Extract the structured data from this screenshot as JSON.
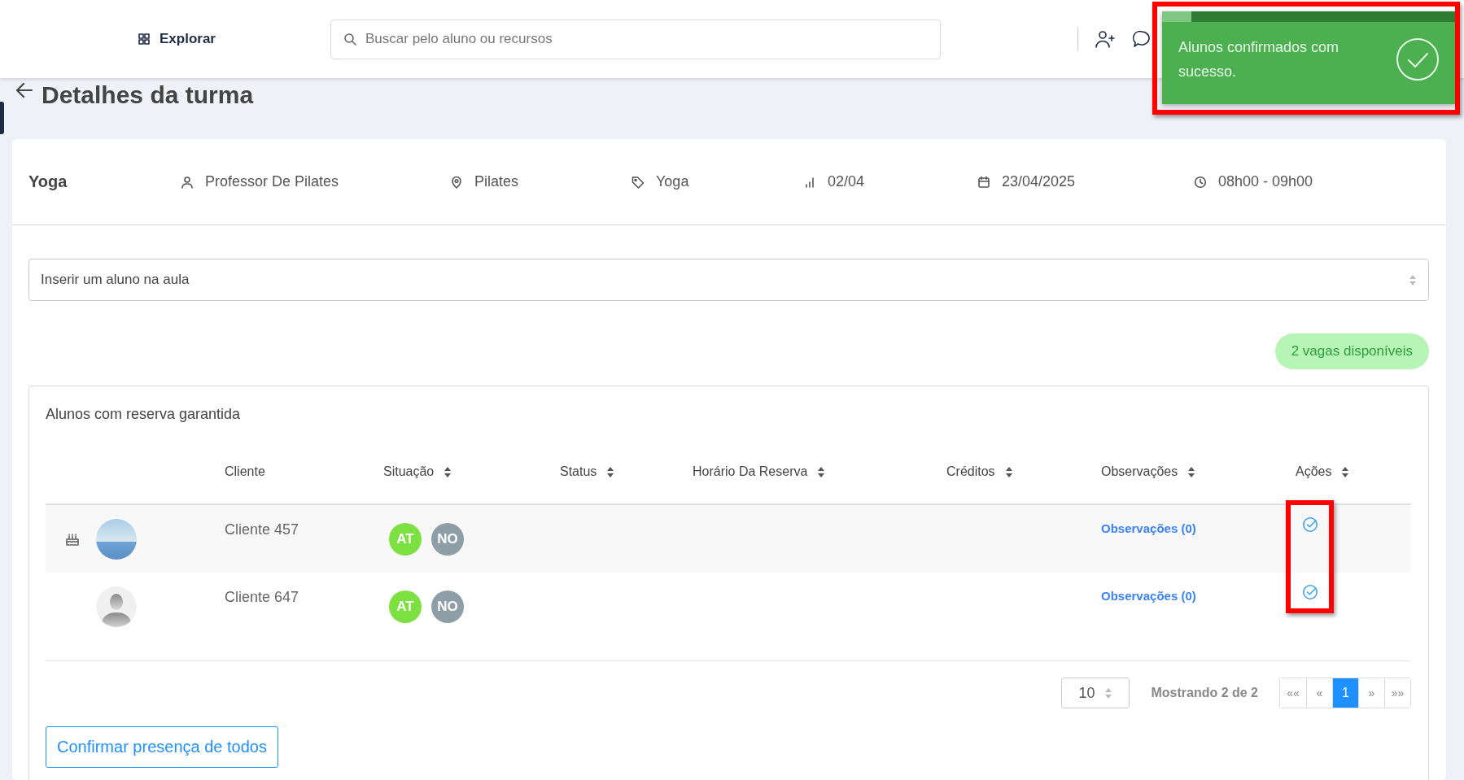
{
  "topbar": {
    "explore_label": "Explorar",
    "search": {
      "placeholder": "Buscar pelo aluno ou recursos"
    }
  },
  "toast": {
    "message": "Alunos confirmados com sucesso.",
    "level": 0.1
  },
  "page_title": "Detalhes da turma",
  "class_info": {
    "name": "Yoga",
    "items": [
      {
        "kind": "teacher",
        "text": "Professor De Pilates"
      },
      {
        "kind": "location",
        "text": "Pilates"
      },
      {
        "kind": "tag",
        "text": "Yoga"
      },
      {
        "kind": "capacity",
        "text": "02/04"
      },
      {
        "kind": "date",
        "text": "23/04/2025"
      },
      {
        "kind": "time",
        "text": "08h00 - 09h00"
      }
    ]
  },
  "student_select": {
    "placeholder": "Inserir um aluno na aula"
  },
  "vacancies": "2 vagas disponíveis",
  "panel": {
    "title": "Alunos com reserva garantida",
    "columns": [
      {
        "label": "Cliente",
        "sortable": false
      },
      {
        "label": "Situação",
        "sortable": true
      },
      {
        "label": "Status",
        "sortable": true
      },
      {
        "label": "Horário Da Reserva",
        "sortable": true
      },
      {
        "label": "Créditos",
        "sortable": true
      },
      {
        "label": "Observações",
        "sortable": true
      },
      {
        "label": "Ações",
        "sortable": true
      }
    ],
    "rows": [
      {
        "client": "Cliente 457",
        "birthday": true,
        "kind": "photo",
        "badges": [
          {
            "text": "AT",
            "color": "#7be040"
          },
          {
            "text": "NO",
            "color": "#8e9ea6"
          }
        ],
        "observations": "Observações (0)"
      },
      {
        "client": "Cliente 647",
        "birthday": false,
        "kind": "silhouette",
        "badges": [
          {
            "text": "AT",
            "color": "#7be040"
          },
          {
            "text": "NO",
            "color": "#8e9ea6"
          }
        ],
        "observations": "Observações (0)"
      }
    ],
    "pagination": {
      "page_size": "10",
      "summary": "Mostrando 2 de 2",
      "pages": [
        {
          "label": "««",
          "selected": false
        },
        {
          "label": "«",
          "selected": false
        },
        {
          "label": "1",
          "selected": true
        },
        {
          "label": "»",
          "selected": false
        },
        {
          "label": "»»",
          "selected": false
        }
      ]
    },
    "confirm_button": "Confirmar presença de todos"
  }
}
